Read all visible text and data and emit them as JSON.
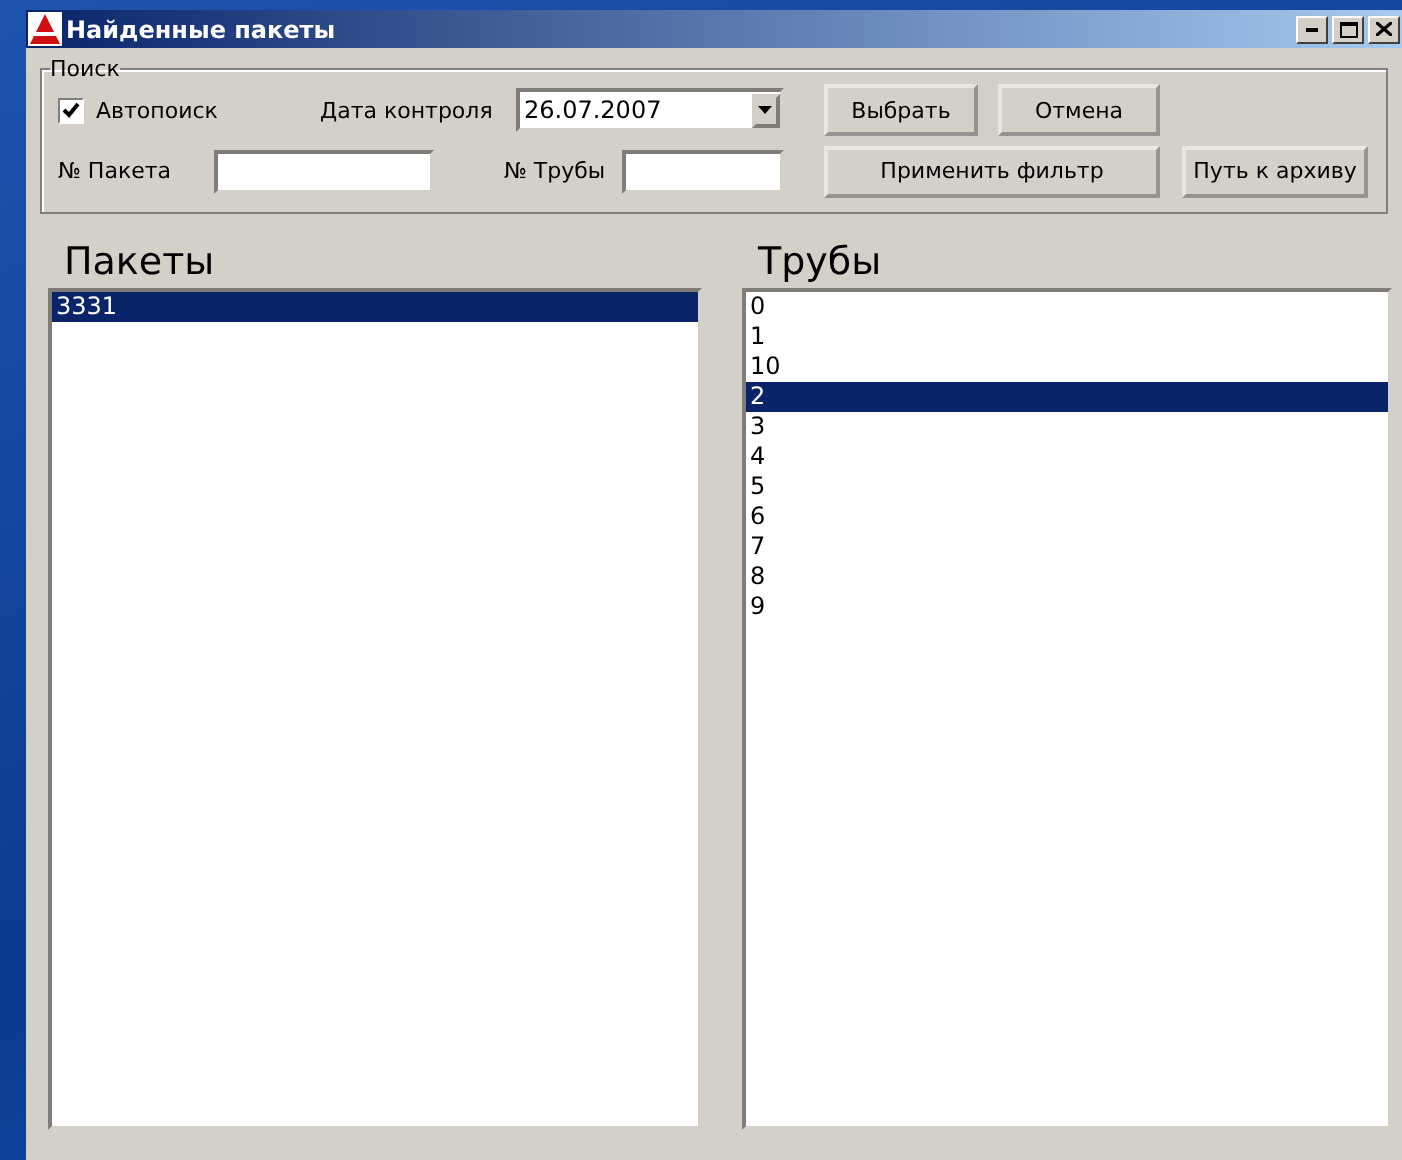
{
  "window": {
    "title": "Найденные пакеты"
  },
  "search": {
    "legend": "Поиск",
    "autosearch": {
      "label": "Автопоиск",
      "checked": true
    },
    "date_label": "Дата контроля",
    "date_value": "26.07.2007",
    "packet_label": "№ Пакета",
    "pipe_label": "№ Трубы"
  },
  "buttons": {
    "select": "Выбрать",
    "cancel": "Отмена",
    "apply_filter": "Применить фильтр",
    "archive_path": "Путь к архиву"
  },
  "packets": {
    "heading": "Пакеты",
    "items": [
      {
        "label": "3331",
        "selected": true
      }
    ]
  },
  "pipes": {
    "heading": "Трубы",
    "items": [
      {
        "label": "0",
        "selected": false
      },
      {
        "label": "1",
        "selected": false
      },
      {
        "label": "10",
        "selected": false
      },
      {
        "label": "2",
        "selected": true
      },
      {
        "label": "3",
        "selected": false
      },
      {
        "label": "4",
        "selected": false
      },
      {
        "label": "5",
        "selected": false
      },
      {
        "label": "6",
        "selected": false
      },
      {
        "label": "7",
        "selected": false
      },
      {
        "label": "8",
        "selected": false
      },
      {
        "label": "9",
        "selected": false
      }
    ]
  }
}
